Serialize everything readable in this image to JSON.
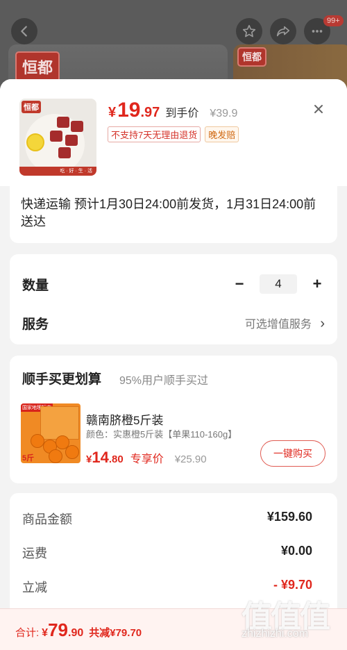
{
  "background": {
    "brand_logo_text": "恒都",
    "badge_count": "99+"
  },
  "product": {
    "currency": "¥",
    "price_int": "19",
    "price_dec": ".97",
    "price_note": "到手价",
    "original_price": "¥39.9",
    "tags": [
      "不支持7天无理由退货",
      "晚发赔"
    ],
    "thumb_logo": "恒都",
    "thumb_slogan": "吃 · 好 · 生 · 活"
  },
  "delivery": {
    "text": "快递运输 预计1月30日24:00前发货，1月31日24:00前送达"
  },
  "quantity": {
    "label": "数量",
    "minus": "−",
    "value": "4",
    "plus": "+"
  },
  "service": {
    "label": "服务",
    "value": "可选增值服务",
    "chevron": "›"
  },
  "upsell": {
    "title": "顺手买更划算",
    "subtitle": "95%用户顺手买过",
    "item_name": "赣南脐橙5斤装",
    "item_spec": "颜色：实惠橙5斤装【单果110-160g】",
    "currency": "¥",
    "price_int": "14",
    "price_dec": ".80",
    "price_label": "专享价",
    "original_price": "¥25.90",
    "buy_button": "一键购买",
    "thumb_weight": "5斤",
    "thumb_top_tag": "国家地理标志"
  },
  "summary": {
    "goods_label": "商品金额",
    "goods_value": "¥159.60",
    "shipping_label": "运费",
    "shipping_value": "¥0.00",
    "discount_label": "立减",
    "discount_value": "- ¥9.70"
  },
  "bottom_bar": {
    "total_label": "合计:",
    "currency": "¥",
    "total_int": "79",
    "total_dec": ".90",
    "saved": "共减¥79.70"
  },
  "watermark": {
    "glyphs": "值值值",
    "url": "zhizhizhi.com"
  },
  "colors": {
    "accent_red": "#e0271d",
    "amber": "#d06a14"
  }
}
